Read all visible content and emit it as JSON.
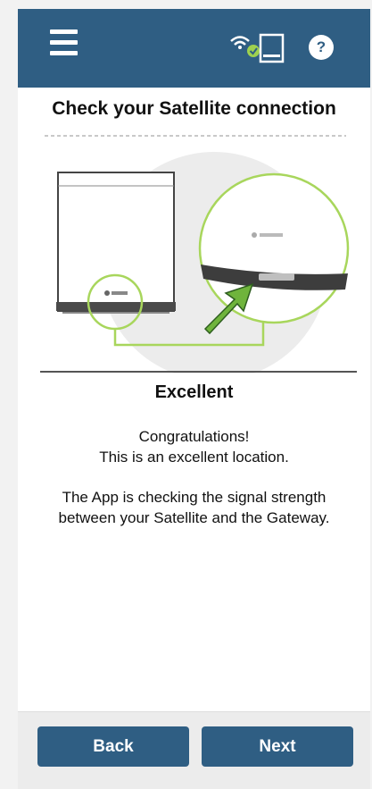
{
  "header": {
    "menu_icon": "hamburger-menu-icon",
    "status_icon": "wifi-satellite-status-icon",
    "help_label": "?"
  },
  "main": {
    "title": "Check your Satellite connection",
    "status": "Excellent",
    "congrats_line1": "Congratulations!",
    "congrats_line2": "This is an excellent location.",
    "info_line1": "The App is checking the signal strength",
    "info_line2": "between your Satellite and the Gateway."
  },
  "footer": {
    "back_label": "Back",
    "next_label": "Next"
  },
  "colors": {
    "header_bg": "#2f5e83",
    "button_bg": "#2f5e83",
    "indicator_green": "#a8d65c",
    "arrow_green": "#6fb43c"
  }
}
